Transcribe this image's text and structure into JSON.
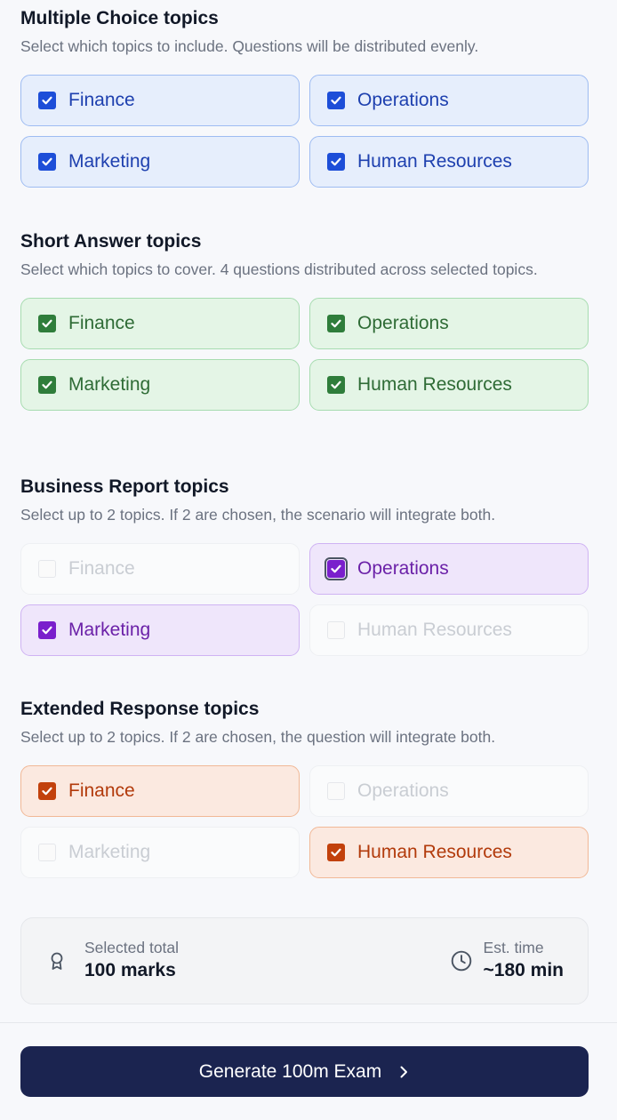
{
  "sections": [
    {
      "title": "Multiple Choice topics",
      "description": "Select which topics to include. Questions will be distributed evenly.",
      "options": [
        {
          "label": "Finance",
          "checked": true
        },
        {
          "label": "Operations",
          "checked": true
        },
        {
          "label": "Marketing",
          "checked": true
        },
        {
          "label": "Human Resources",
          "checked": true
        }
      ]
    },
    {
      "title": "Short Answer topics",
      "description": "Select which topics to cover. 4 questions distributed across selected topics.",
      "options": [
        {
          "label": "Finance",
          "checked": true
        },
        {
          "label": "Operations",
          "checked": true
        },
        {
          "label": "Marketing",
          "checked": true
        },
        {
          "label": "Human Resources",
          "checked": true
        }
      ]
    },
    {
      "title": "Business Report topics",
      "description": "Select up to 2 topics. If 2 are chosen, the scenario will integrate both.",
      "options": [
        {
          "label": "Finance",
          "checked": false
        },
        {
          "label": "Operations",
          "checked": true
        },
        {
          "label": "Marketing",
          "checked": true
        },
        {
          "label": "Human Resources",
          "checked": false
        }
      ]
    },
    {
      "title": "Extended Response topics",
      "description": "Select up to 2 topics. If 2 are chosen, the question will integrate both.",
      "options": [
        {
          "label": "Finance",
          "checked": true
        },
        {
          "label": "Operations",
          "checked": false
        },
        {
          "label": "Marketing",
          "checked": false
        },
        {
          "label": "Human Resources",
          "checked": true
        }
      ]
    }
  ],
  "summary": {
    "total_label": "Selected total",
    "total_value": "100 marks",
    "time_label": "Est. time",
    "time_value": "~180 min",
    "total_icon": "award-icon",
    "time_icon": "clock-icon"
  },
  "generate_button": {
    "label": "Generate 100m Exam",
    "icon": "chevron-right-icon"
  },
  "colors": {
    "multiple_choice": "#1d4ed8",
    "short_answer": "#2f7d3b",
    "business_report": "#7a1fcc",
    "extended_response": "#c2410c",
    "button": "#1b2450"
  }
}
